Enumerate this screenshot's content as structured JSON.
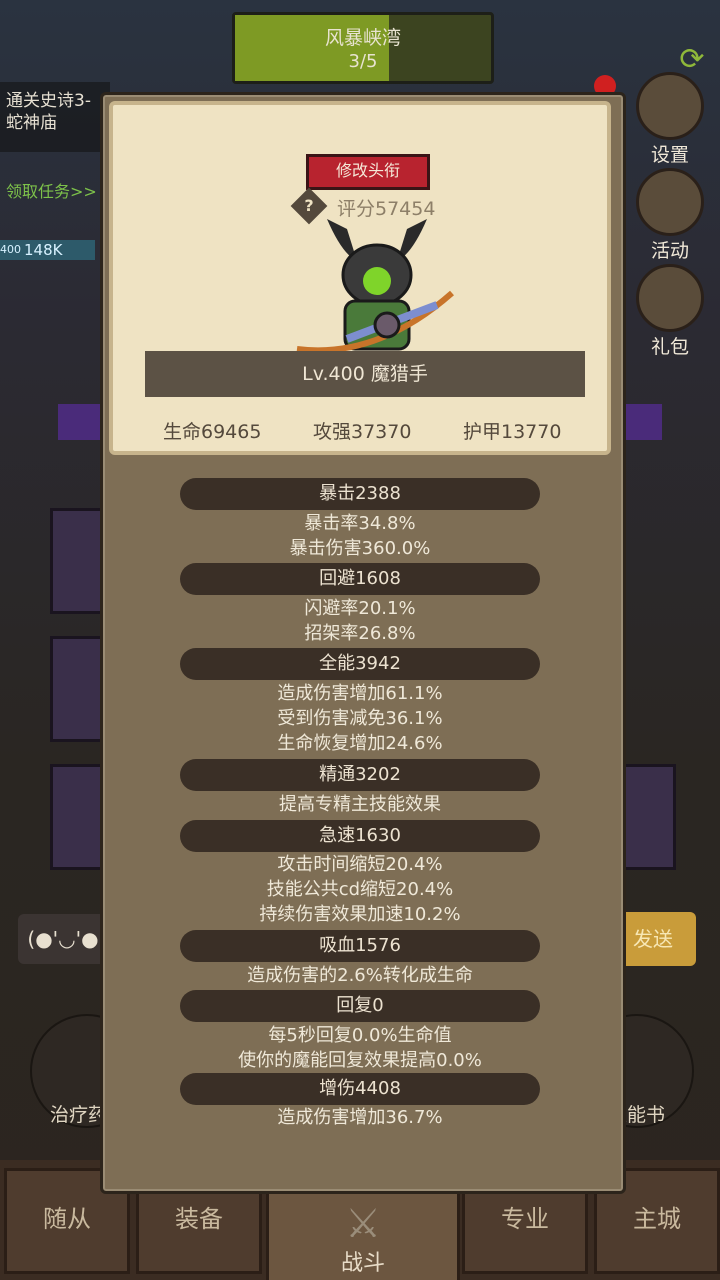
{
  "top": {
    "zone_title": "风暴峡湾",
    "progress": "3/5",
    "progress_fraction": 0.6
  },
  "left_panel": {
    "quest_line1": "通关史诗3-",
    "quest_line2": "蛇神庙",
    "quest_link": "领取任务>>",
    "hp_small": "400",
    "hp_value": "148K"
  },
  "side_buttons": [
    {
      "label": "设置",
      "icon": "gear-icon"
    },
    {
      "label": "活动",
      "icon": "scroll-icon"
    },
    {
      "label": "礼包",
      "icon": "gift-icon"
    }
  ],
  "chat": {
    "emote": "(●'◡'●",
    "send_label": "发送"
  },
  "potions": [
    {
      "label": "治疗药"
    },
    {
      "label": "技能书"
    }
  ],
  "bottom_nav": [
    "随从",
    "装备",
    "战斗",
    "专业",
    "主城"
  ],
  "modal": {
    "rename_button": "修改头衔",
    "help_icon": "?",
    "score": "评分57454",
    "level_class": "Lv.400 魔猎手",
    "life": "生命69465",
    "attack": "攻强37370",
    "armor": "护甲13770",
    "sections": [
      {
        "header": "暴击2388",
        "lines": [
          "暴击率34.8%",
          "暴击伤害360.0%"
        ]
      },
      {
        "header": "回避1608",
        "lines": [
          "闪避率20.1%",
          "招架率26.8%"
        ]
      },
      {
        "header": "全能3942",
        "lines": [
          "造成伤害增加61.1%",
          "受到伤害减免36.1%",
          "生命恢复增加24.6%"
        ]
      },
      {
        "header": "精通3202",
        "lines": [
          "提高专精主技能效果"
        ]
      },
      {
        "header": "急速1630",
        "lines": [
          "攻击时间缩短20.4%",
          "技能公共cd缩短20.4%",
          "持续伤害效果加速10.2%"
        ]
      },
      {
        "header": "吸血1576",
        "lines": [
          "造成伤害的2.6%转化成生命"
        ]
      },
      {
        "header": "回复0",
        "lines": [
          "每5秒回复0.0%生命值",
          "使你的魔能回复效果提高0.0%"
        ]
      },
      {
        "header": "增伤4408",
        "lines": [
          "造成伤害增加36.7%"
        ]
      }
    ]
  }
}
